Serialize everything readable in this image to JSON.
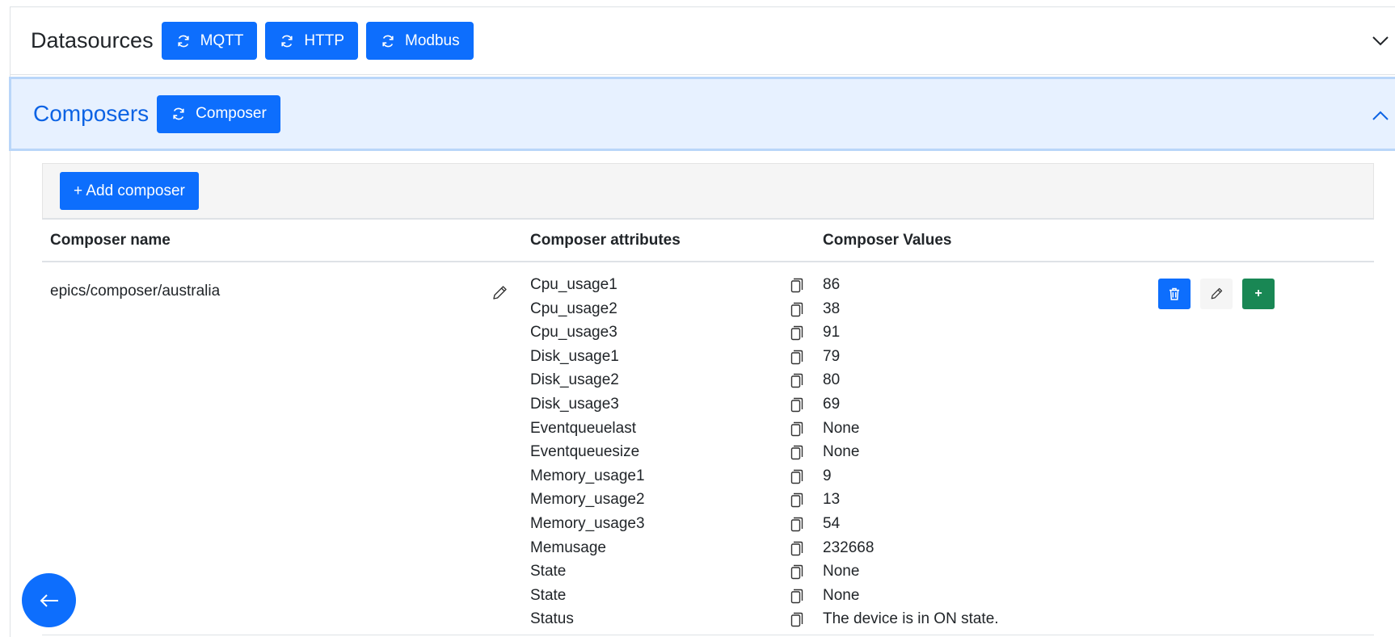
{
  "datasources": {
    "title": "Datasources",
    "buttons": [
      "MQTT",
      "HTTP",
      "Modbus"
    ]
  },
  "composers": {
    "title": "Composers",
    "button": "Composer"
  },
  "toolbar": {
    "add_label": "+ Add composer"
  },
  "table": {
    "headers": {
      "name": "Composer name",
      "attributes": "Composer attributes",
      "values": "Composer Values"
    },
    "rows": [
      {
        "name": "epics/composer/australia",
        "attributes": [
          {
            "name": "Cpu_usage1",
            "value": "86"
          },
          {
            "name": "Cpu_usage2",
            "value": "38"
          },
          {
            "name": "Cpu_usage3",
            "value": "91"
          },
          {
            "name": "Disk_usage1",
            "value": "79"
          },
          {
            "name": "Disk_usage2",
            "value": "80"
          },
          {
            "name": "Disk_usage3",
            "value": "69"
          },
          {
            "name": "Eventqueuelast",
            "value": "None"
          },
          {
            "name": "Eventqueuesize",
            "value": "None"
          },
          {
            "name": "Memory_usage1",
            "value": "9"
          },
          {
            "name": "Memory_usage2",
            "value": "13"
          },
          {
            "name": "Memory_usage3",
            "value": "54"
          },
          {
            "name": "Memusage",
            "value": "232668"
          },
          {
            "name": "State",
            "value": "None"
          },
          {
            "name": "State",
            "value": "None"
          },
          {
            "name": "Status",
            "value": "The device is in ON state."
          }
        ],
        "add_action_label": "+"
      }
    ]
  },
  "icons": {
    "refresh": "refresh-icon",
    "chevron_down": "chevron-down-icon",
    "chevron_up": "chevron-up-icon",
    "pencil": "pencil-icon",
    "copy": "copy-icon",
    "trash": "trash-icon",
    "arrow_left": "arrow-left-icon"
  },
  "colors": {
    "primary": "#0d6efd",
    "success": "#198754",
    "active_header_bg": "#e7f1ff",
    "active_header_text": "#0c63e4"
  }
}
